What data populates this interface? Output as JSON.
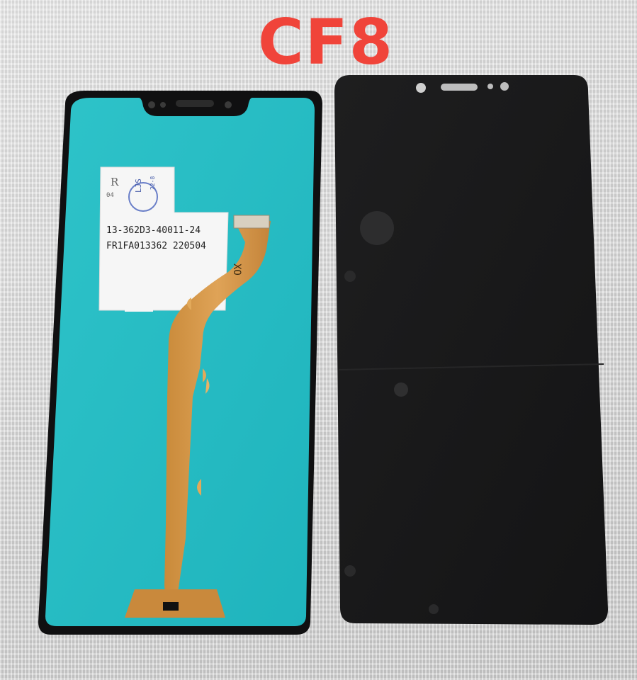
{
  "title": "CF8",
  "label": {
    "line1": "13-362D3-40011-24",
    "line2": "FR1FA013362 220504",
    "stamp": "LJS",
    "stamp_small": "22-8",
    "r_mark": "R",
    "r_small": "04"
  },
  "flex_mark": "XO"
}
